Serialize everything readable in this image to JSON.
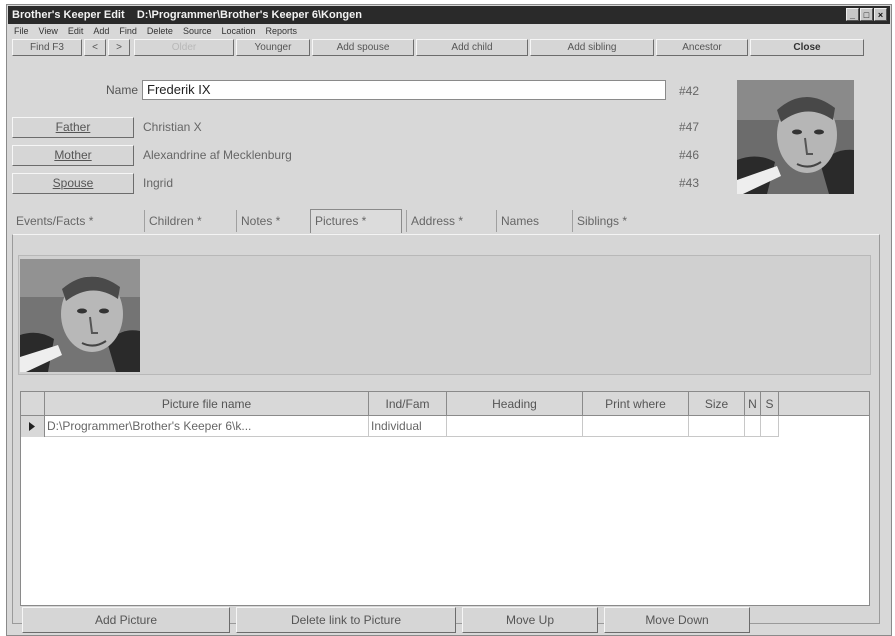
{
  "window": {
    "title": "Brother's Keeper Edit    D:\\Programmer\\Brother's Keeper 6\\Kongen",
    "controls": [
      "_",
      "□",
      "×"
    ]
  },
  "menu": [
    "File",
    "View",
    "Edit",
    "Add",
    "Find",
    "Delete",
    "Source",
    "Location",
    "Reports"
  ],
  "toolbar": {
    "find": "Find  F3",
    "prev": "<",
    "next": ">",
    "older": "Older",
    "younger": "Younger",
    "add_spouse": "Add spouse",
    "add_child": "Add child",
    "add_sibling": "Add sibling",
    "ancestor": "Ancestor",
    "close": "Close"
  },
  "person": {
    "name_label": "Name",
    "name": "Frederik IX",
    "id": "#42",
    "father_label": "Father",
    "father": "Christian X",
    "father_id": "#47",
    "mother_label": "Mother",
    "mother": "Alexandrine af Mecklenburg",
    "mother_id": "#46",
    "spouse_label": "Spouse",
    "spouse": "Ingrid",
    "spouse_id": "#43"
  },
  "tabs": [
    {
      "label": "Events/Facts *",
      "active": false
    },
    {
      "label": "Children *",
      "active": false
    },
    {
      "label": "Notes *",
      "active": false
    },
    {
      "label": "Pictures *",
      "active": true
    },
    {
      "label": "Address *",
      "active": false
    },
    {
      "label": "Names",
      "active": false
    },
    {
      "label": "Siblings *",
      "active": false
    }
  ],
  "grid": {
    "columns": [
      "Picture file name",
      "Ind/Fam",
      "Heading",
      "Print where",
      "Size",
      "N",
      "S"
    ],
    "rows": [
      [
        "D:\\Programmer\\Brother's Keeper 6\\k...",
        "Individual",
        "",
        "",
        "",
        "",
        ""
      ]
    ]
  },
  "actions": {
    "add_picture": "Add Picture",
    "delete_link": "Delete link to Picture",
    "move_up": "Move Up",
    "move_down": "Move Down"
  }
}
